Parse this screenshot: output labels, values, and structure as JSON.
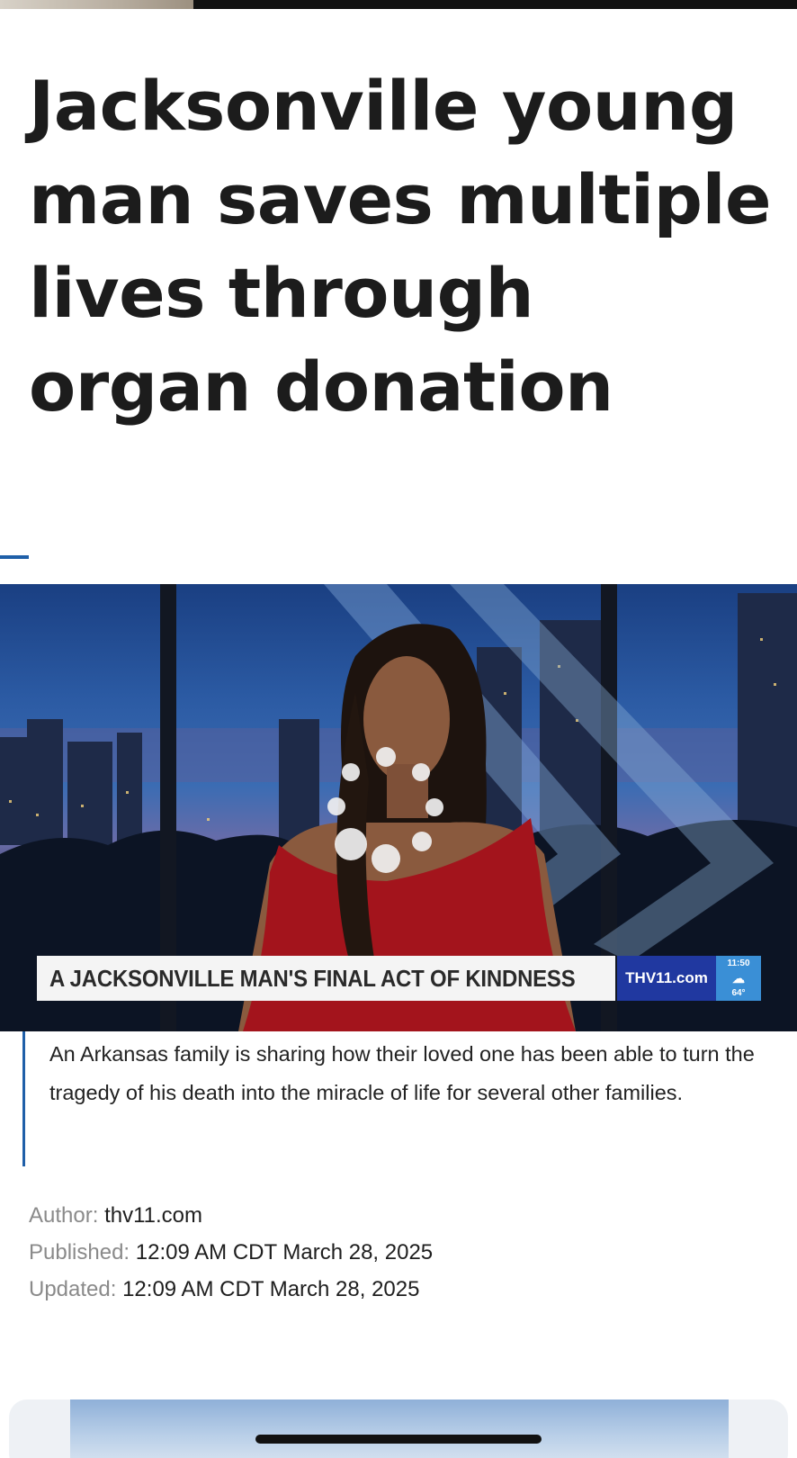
{
  "article": {
    "headline": "Jacksonville young man saves multiple lives through organ donation",
    "summary": "An Arkansas family is sharing how their loved one has been able to turn the tragedy of his death into the miracle of life for several other families.",
    "meta": {
      "author_label": "Author:",
      "author": "thv11.com",
      "published_label": "Published:",
      "published": "12:09 AM CDT March 28, 2025",
      "updated_label": "Updated:",
      "updated": "12:09 AM CDT March 28, 2025"
    }
  },
  "video": {
    "lower_third": "A JACKSONVILLE MAN'S  FINAL ACT OF KINDNESS",
    "brand": "THV11.com",
    "time": "11:50",
    "temperature": "64°",
    "weather_icon": "cloud-icon",
    "state": "loading"
  },
  "colors": {
    "accent": "#1f5fa8",
    "brand_blue": "#2038a0",
    "weather_blue": "#3a8fd6",
    "dress_red": "#a3141c"
  }
}
